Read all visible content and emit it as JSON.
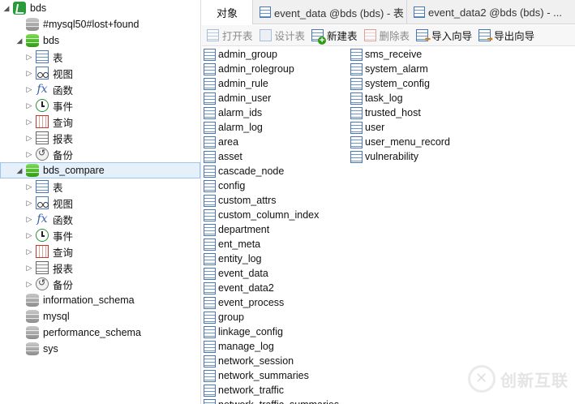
{
  "tabs": [
    {
      "label": "对象",
      "active": true
    },
    {
      "label": "event_data @bds (bds) - 表",
      "active": false
    },
    {
      "label": "event_data2 @bds (bds) - ...",
      "active": false
    }
  ],
  "toolbar": {
    "open_table": "打开表",
    "design_table": "设计表",
    "new_table": "新建表",
    "delete_table": "删除表",
    "import_wizard": "导入向导",
    "export_wizard": "导出向导"
  },
  "tree": {
    "connection": "bds",
    "node_lost_found": "#mysql50#lost+found",
    "db_bds": "bds",
    "bds_children": [
      "表",
      "视图",
      "函数",
      "事件",
      "查询",
      "报表",
      "备份"
    ],
    "db_bds_compare": "bds_compare",
    "bds_compare_children": [
      "表",
      "视图",
      "函数",
      "事件",
      "查询",
      "报表",
      "备份"
    ],
    "other_dbs": [
      "information_schema",
      "mysql",
      "performance_schema",
      "sys"
    ]
  },
  "objects": {
    "column1": [
      "admin_group",
      "admin_rolegroup",
      "admin_rule",
      "admin_user",
      "alarm_ids",
      "alarm_log",
      "area",
      "asset",
      "cascade_node",
      "config",
      "custom_attrs",
      "custom_column_index",
      "department",
      "ent_meta",
      "entity_log",
      "event_data",
      "event_data2",
      "event_process",
      "group",
      "linkage_config",
      "manage_log",
      "network_session",
      "network_summaries",
      "network_traffic",
      "network_traffic_summaries"
    ],
    "column2": [
      "sms_receive",
      "system_alarm",
      "system_config",
      "task_log",
      "trusted_host",
      "user",
      "user_menu_record",
      "vulnerability"
    ]
  },
  "watermark": "创新互联",
  "colors": {
    "db_active": "#2e9b12",
    "selection_bg": "#e5f0fb",
    "selection_border": "#9bc6ee"
  }
}
